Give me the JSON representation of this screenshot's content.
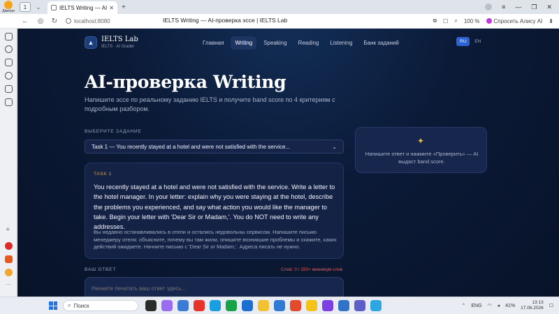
{
  "browser": {
    "profile_name": "Дмитри",
    "tab_count": "1",
    "tab_title": "IELTS Writing — AI-проверка эссе | IELTS Lab",
    "url": "localhost:8080",
    "page_title": "IELTS Writing — AI-проверка эссе | IELTS Lab",
    "zoom": "100 %",
    "alisa_label": "Спросить Алису AI"
  },
  "site": {
    "brand_name": "IELTS Lab",
    "brand_sub": "IELTS · AI Grader",
    "nav": [
      "Главная",
      "Writing",
      "Speaking",
      "Reading",
      "Listening",
      "Банк заданий"
    ],
    "active_nav": "Writing",
    "lang": [
      "RU",
      "EN"
    ],
    "active_lang": "RU"
  },
  "hero": {
    "title": "AI-проверка Writing",
    "subtitle": "Напишите эссе по реальному заданию IELTS и получите band score по 4 критериям с подробным разбором."
  },
  "task": {
    "select_label": "ВЫБЕРИТЕ ЗАДАНИЕ",
    "selected": "Task 1 — You recently stayed at a hotel and were not satisfied with the service...",
    "tag": "TASK 1",
    "prompt_en": "You recently stayed at a hotel and were not satisfied with the service. Write a letter to the hotel manager. In your letter: explain why you were staying at the hotel, describe the problems you experienced, and say what action you would like the manager to take. Begin your letter with 'Dear Sir or Madam,'. You do NOT need to write any addresses.",
    "prompt_ru": "Вы недавно останавливались в отели и остались недовольны сервисом. Напишите письмо менеджеру отеля: объясните, почему вы там жили, опишите возникшие проблемы и скажите, каких действий ожидаете. Начните письмо с 'Dear Sir or Madam,'. Адреса писать не нужно."
  },
  "answer": {
    "label": "ВАШ ОТВЕТ",
    "word_count": "Слов: 0 / 150+ минимум слов",
    "placeholder": "Начните печатать ваш ответ здесь..."
  },
  "result": {
    "text": "Напишите ответ и нажмите «Проверить» — AI выдаст band score."
  },
  "taskbar": {
    "search": "Поиск",
    "lang": "ENG",
    "battery": "41%",
    "time": "13:13",
    "date": "17.06.2026"
  }
}
